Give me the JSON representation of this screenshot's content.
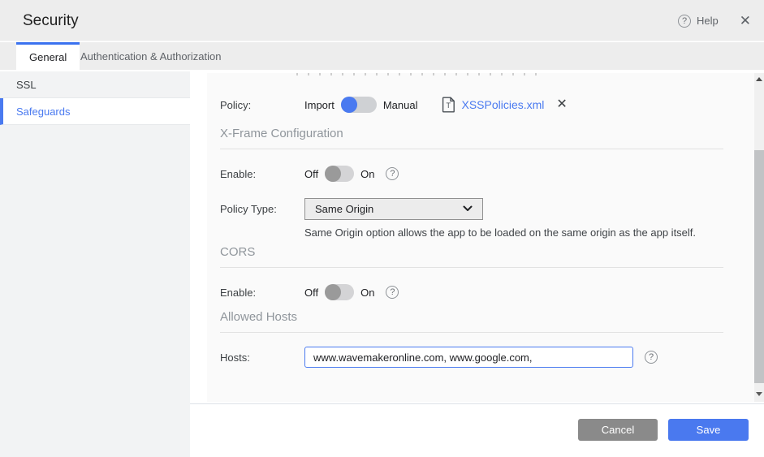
{
  "window": {
    "title": "Security",
    "help_label": "Help"
  },
  "tabs": [
    {
      "label": "General",
      "active": true
    },
    {
      "label": "Authentication & Authorization",
      "active": false
    }
  ],
  "sidebar": {
    "items": [
      {
        "label": "SSL",
        "active": false
      },
      {
        "label": "Safeguards",
        "active": true
      }
    ]
  },
  "content": {
    "policy": {
      "label": "Policy:",
      "option_left": "Import",
      "option_right": "Manual",
      "selected": "Import",
      "file_name": "XSSPolicies.xml"
    },
    "xframe": {
      "section": "X-Frame Configuration",
      "enable_label": "Enable:",
      "off": "Off",
      "on": "On",
      "enabled": false,
      "policy_type_label": "Policy Type:",
      "policy_type_value": "Same Origin",
      "description": "Same Origin option allows the app to be loaded on the same origin as the app itself."
    },
    "cors": {
      "section": "CORS",
      "enable_label": "Enable:",
      "off": "Off",
      "on": "On",
      "enabled": false
    },
    "allowed_hosts": {
      "section": "Allowed Hosts",
      "hosts_label": "Hosts:",
      "hosts_value": "www.wavemakeronline.com, www.google.com, "
    }
  },
  "footer": {
    "cancel_label": "Cancel",
    "save_label": "Save"
  },
  "colors": {
    "accent": "#4a7af0",
    "tab_indicator": "#3b72ef",
    "save_button": "#4a79ef",
    "cancel_button": "#8a8a8a",
    "link": "#4a7af0",
    "toggle_off_knob": "#9a9a9a"
  }
}
